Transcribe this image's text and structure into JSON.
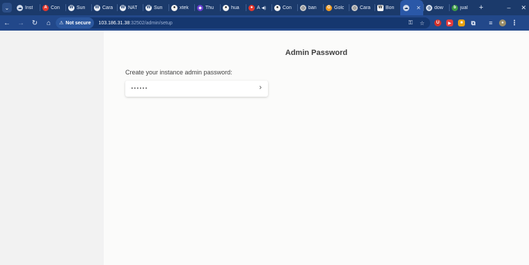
{
  "browser": {
    "tabs": [
      {
        "title": "Inst",
        "icon": "cloud-icon"
      },
      {
        "title": "Con",
        "icon": "red-logo-icon"
      },
      {
        "title": "Sun",
        "icon": "wordpress-icon"
      },
      {
        "title": "Cara",
        "icon": "wordpress-icon"
      },
      {
        "title": "NAT",
        "icon": "wordpress-icon"
      },
      {
        "title": "Sun",
        "icon": "wordpress-icon"
      },
      {
        "title": "xtek",
        "icon": "github-icon"
      },
      {
        "title": "Thu",
        "icon": "purple-shield-icon"
      },
      {
        "title": "hua",
        "icon": "github-icon"
      },
      {
        "title": "A",
        "icon": "red-record-icon"
      },
      {
        "title": "Con",
        "icon": "github-icon"
      },
      {
        "title": "ban",
        "icon": "gray-circle-icon"
      },
      {
        "title": "Golc",
        "icon": "orange-coin-icon"
      },
      {
        "title": "Cara",
        "icon": "gray-circle-icon"
      },
      {
        "title": "Bon",
        "icon": "w-logo-icon"
      },
      {
        "title": "",
        "icon": "cloud-icon",
        "active": true
      },
      {
        "title": "dow",
        "icon": "globe-icon"
      },
      {
        "title": "jual",
        "icon": "green-logo-icon"
      }
    ],
    "new_tab": "+",
    "window_controls": {
      "minimize": "–",
      "close": "✕"
    },
    "address": {
      "security_label": "Not secure",
      "host": "103.186.31.38",
      "path": ":32502/admin/setup"
    }
  },
  "setup": {
    "heading": "Admin Password",
    "prompt": "Create your instance admin password:",
    "password_value": "••••••",
    "submit_icon": "chevron-right-icon"
  }
}
